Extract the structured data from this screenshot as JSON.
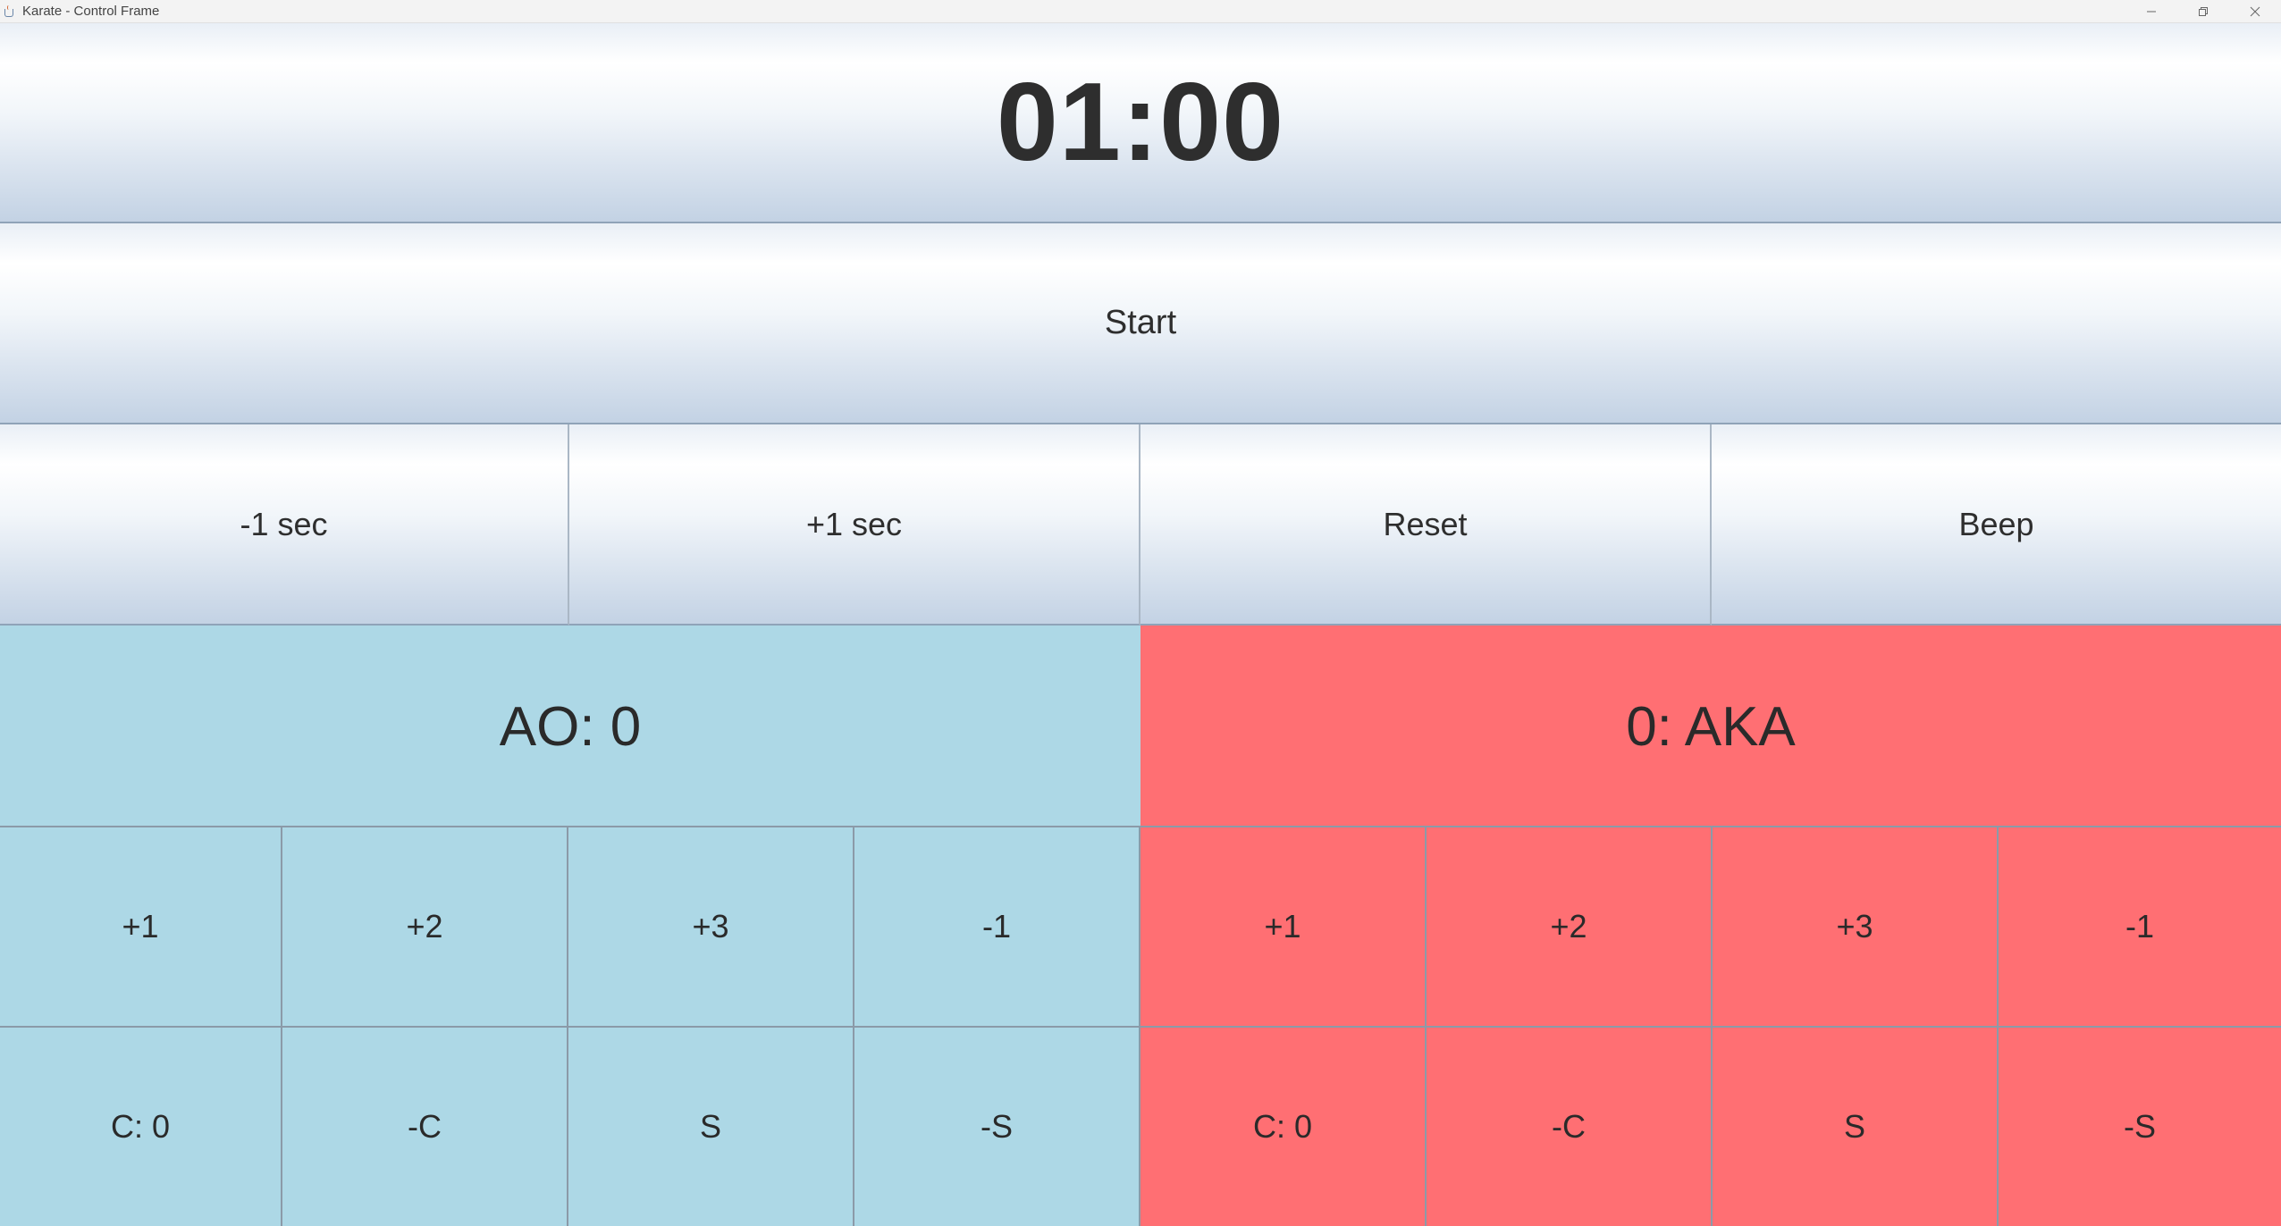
{
  "window": {
    "title": "Karate - Control Frame",
    "controls": [
      "minimize",
      "restore",
      "close"
    ]
  },
  "timer": {
    "display": "01:00"
  },
  "start_button": {
    "label": "Start"
  },
  "time_controls": {
    "minus_sec": "-1 sec",
    "plus_sec": "+1 sec",
    "reset": "Reset",
    "beep": "Beep"
  },
  "ao": {
    "score_label": "AO: 0",
    "color": "#add8e6",
    "points": {
      "plus1": "+1",
      "plus2": "+2",
      "plus3": "+3",
      "minus1": "-1"
    },
    "penalties": {
      "c_count": "C: 0",
      "minus_c": "-C",
      "s": "S",
      "minus_s": "-S"
    }
  },
  "aka": {
    "score_label": "0: AKA",
    "color": "#ff6f73",
    "points": {
      "plus1": "+1",
      "plus2": "+2",
      "plus3": "+3",
      "minus1": "-1"
    },
    "penalties": {
      "c_count": "C: 0",
      "minus_c": "-C",
      "s": "S",
      "minus_s": "-S"
    }
  }
}
